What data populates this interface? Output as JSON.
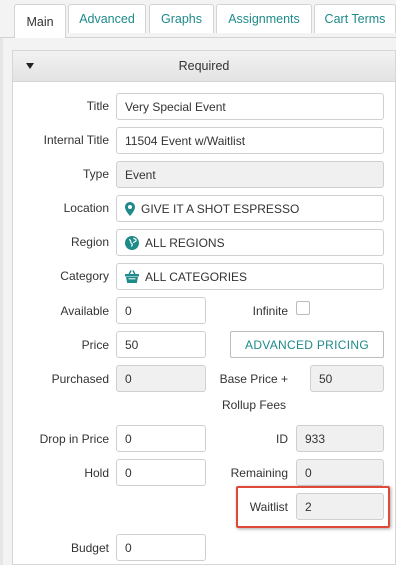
{
  "tabs": [
    {
      "label": "Main",
      "active": true
    },
    {
      "label": "Advanced",
      "active": false
    },
    {
      "label": "Graphs",
      "active": false
    },
    {
      "label": "Assignments",
      "active": false
    },
    {
      "label": "Cart Terms",
      "active": false
    }
  ],
  "section": {
    "title": "Required"
  },
  "fields": {
    "title": {
      "label": "Title",
      "value": "Very Special Event"
    },
    "internal_title": {
      "label": "Internal Title",
      "value": "11504 Event w/Waitlist"
    },
    "type": {
      "label": "Type",
      "value": "Event"
    },
    "location": {
      "label": "Location",
      "value": "GIVE IT A SHOT ESPRESSO",
      "icon": "map-pin-icon"
    },
    "region": {
      "label": "Region",
      "value": "ALL REGIONS",
      "icon": "globe-icon"
    },
    "category": {
      "label": "Category",
      "value": "ALL CATEGORIES",
      "icon": "basket-icon"
    },
    "available": {
      "label": "Available",
      "value": "0"
    },
    "infinite": {
      "label": "Infinite",
      "checked": false
    },
    "price": {
      "label": "Price",
      "value": "50"
    },
    "advanced_pricing": {
      "label": "ADVANCED PRICING"
    },
    "purchased": {
      "label": "Purchased",
      "value": "0"
    },
    "base_price": {
      "label_line1": "Base Price +",
      "label_line2": "Rollup Fees",
      "value": "50"
    },
    "drop_in_price": {
      "label": "Drop in Price",
      "value": "0"
    },
    "id": {
      "label": "ID",
      "value": "933"
    },
    "hold": {
      "label": "Hold",
      "value": "0"
    },
    "remaining": {
      "label": "Remaining",
      "value": "0"
    },
    "waitlist": {
      "label": "Waitlist",
      "value": "2"
    },
    "budget": {
      "label": "Budget",
      "value": "0"
    }
  },
  "colors": {
    "accent": "#1f8a8a",
    "highlight": "#e0493a"
  }
}
